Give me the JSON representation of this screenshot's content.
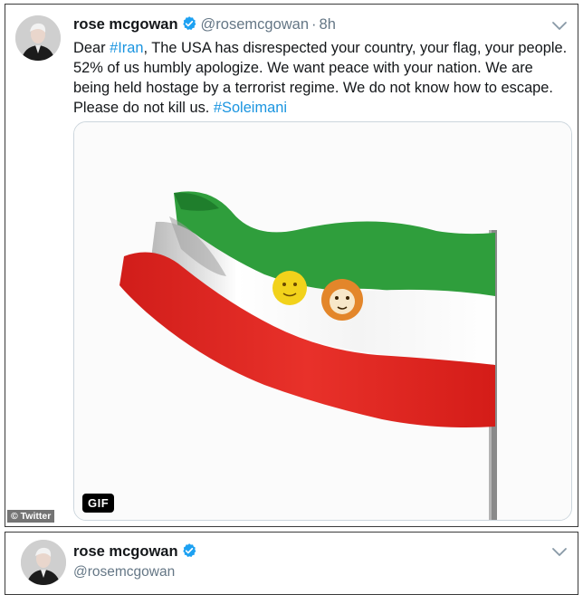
{
  "tweet": {
    "author_name": "rose mcgowan",
    "handle": "@rosemcgowan",
    "separator": "·",
    "time": "8h",
    "text_parts": {
      "p1": "Dear ",
      "hashtag_iran": "#Iran",
      "p2": ", The USA has disrespected your country, your flag, your people. 52% of us humbly apologize. We want peace with your nation. We are being held hostage by a terrorist regime. We do not know how to escape. Please do not kill us. ",
      "hashtag_soleimani": "#Soleimani"
    },
    "media_badge": "GIF"
  },
  "watermark": "© Twitter",
  "second_tweet": {
    "author_name": "rose mcgowan",
    "handle": "@rosemcgowan"
  },
  "colors": {
    "link": "#1b95e0",
    "verified": "#1da1f2",
    "flag_green": "#2f9e3c",
    "flag_red": "#e0241f",
    "muted": "#657786"
  },
  "icons": {
    "verified": "verified-badge-icon",
    "menu": "chevron-down-icon"
  }
}
